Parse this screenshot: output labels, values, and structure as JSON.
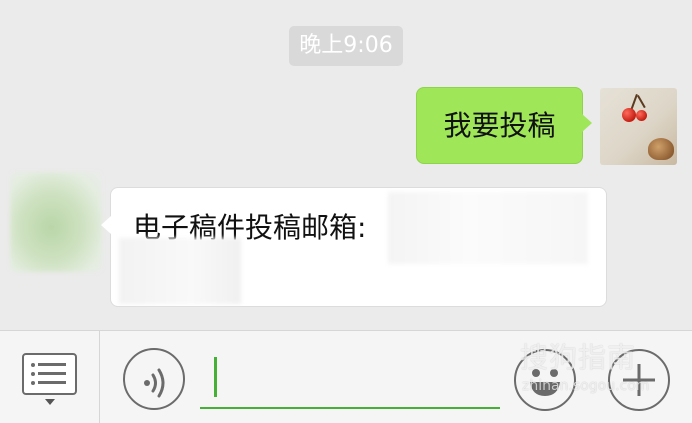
{
  "chat": {
    "timestamp": "晚上9:06",
    "messages": [
      {
        "sender": "self",
        "text": "我要投稿"
      },
      {
        "sender": "other",
        "text": "电子稿件投稿邮箱:"
      }
    ]
  },
  "watermark": {
    "text": "搜狗指南",
    "subtext": "zhinan.sogou.com"
  },
  "colors": {
    "outgoing_bubble": "#9fe658",
    "accent_green": "#45b036",
    "chat_background": "#ebebeb"
  },
  "icons": {
    "menu": "list-menu-icon",
    "voice": "voice-icon",
    "emoji": "emoji-icon",
    "plus": "plus-icon"
  }
}
